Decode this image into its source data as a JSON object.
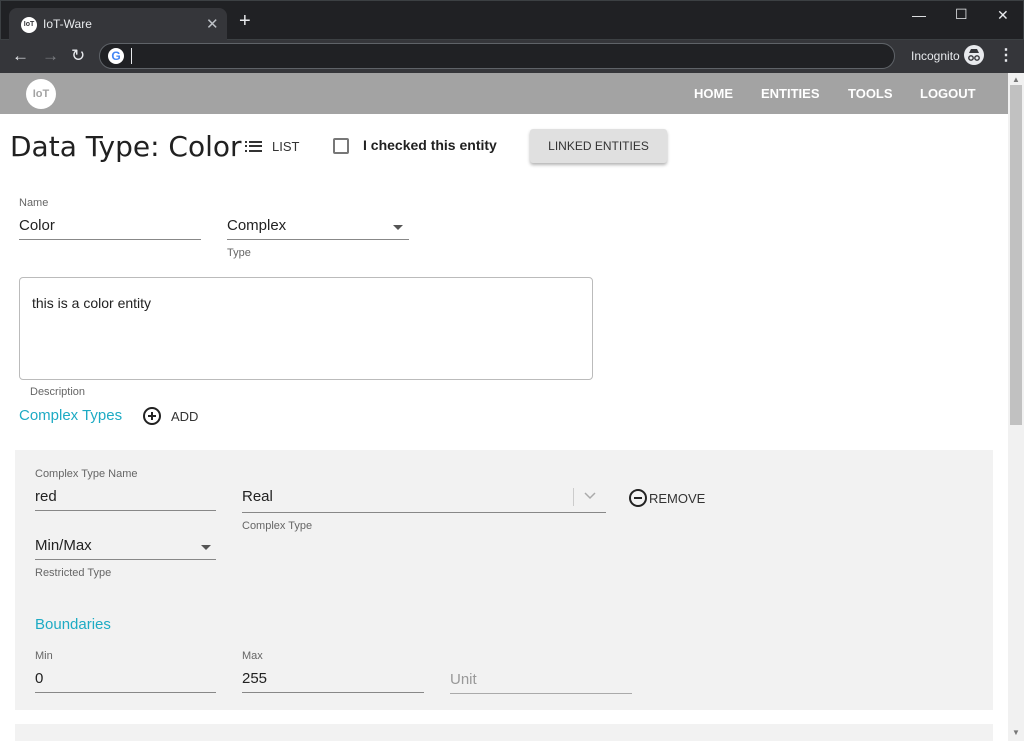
{
  "browser": {
    "tab_title": "IoT-Ware",
    "tab_favicon_text": "IoT",
    "incognito_label": "Incognito",
    "address_value": ""
  },
  "navbar": {
    "logo_text": "IoT",
    "links": [
      "HOME",
      "ENTITIES",
      "TOOLS",
      "LOGOUT"
    ]
  },
  "page": {
    "title": "Data Type: Color",
    "list_label": "LIST",
    "checkbox_label": "I checked this entity",
    "checkbox_checked": false,
    "linked_entities_label": "LINKED ENTITIES"
  },
  "form": {
    "name_label": "Name",
    "name_value": "Color",
    "type_value": "Complex",
    "type_label": "Type",
    "description_value": "this is a color entity",
    "description_label": "Description"
  },
  "complex_types": {
    "section_title": "Complex Types",
    "add_label": "ADD",
    "items": [
      {
        "name_label": "Complex Type Name",
        "name_value": "red",
        "type_value": "Real",
        "type_label": "Complex Type",
        "remove_label": "REMOVE",
        "restricted_value": "Min/Max",
        "restricted_label": "Restricted Type",
        "boundaries_title": "Boundaries",
        "min_label": "Min",
        "min_value": "0",
        "max_label": "Max",
        "max_value": "255",
        "unit_placeholder": "Unit"
      }
    ]
  },
  "colors": {
    "accent": "#1eabc4",
    "navbar_bg": "#a3a3a3",
    "panel_bg": "#f2f2f2"
  }
}
